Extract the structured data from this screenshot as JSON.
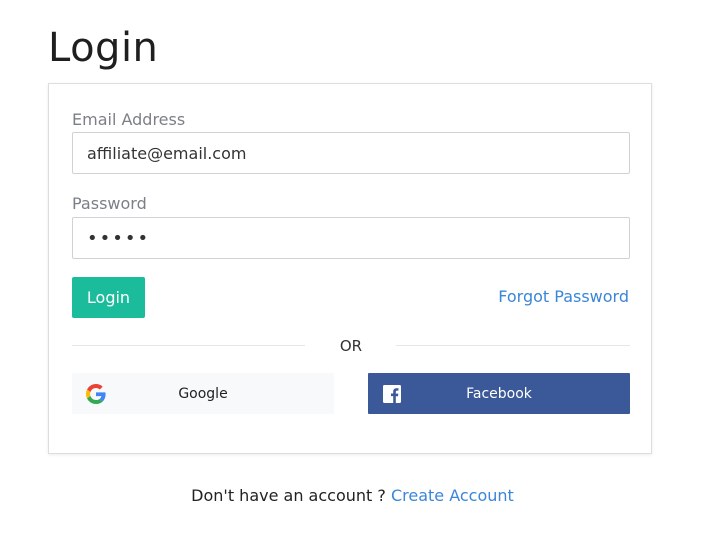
{
  "page": {
    "title": "Login"
  },
  "form": {
    "email_label": "Email Address",
    "email_value": "affiliate@email.com",
    "password_label": "Password",
    "password_value": "•••••",
    "login_label": "Login",
    "forgot_label": "Forgot Password",
    "divider_label": "OR"
  },
  "social": {
    "google_label": "Google",
    "google_icon": "google-icon",
    "facebook_label": "Facebook",
    "facebook_icon": "facebook-icon"
  },
  "footer": {
    "prompt": "Don't have an account ? ",
    "create_label": "Create Account"
  },
  "colors": {
    "primary": "#1abc9c",
    "link": "#3a86d8",
    "facebook": "#3b5998",
    "google_button_bg": "#f8f9fa"
  }
}
